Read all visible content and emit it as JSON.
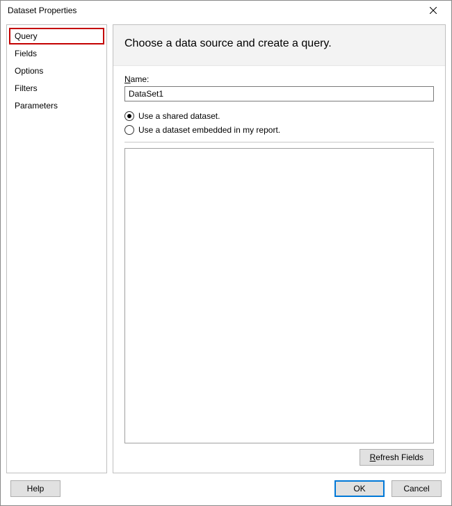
{
  "title": "Dataset Properties",
  "sidebar": {
    "items": [
      {
        "label": "Query",
        "highlight": true
      },
      {
        "label": "Fields",
        "highlight": false
      },
      {
        "label": "Options",
        "highlight": false
      },
      {
        "label": "Filters",
        "highlight": false
      },
      {
        "label": "Parameters",
        "highlight": false
      }
    ]
  },
  "main": {
    "heading": "Choose a data source and create a query.",
    "name_label_prefix": "N",
    "name_label_rest": "ame:",
    "name_value": "DataSet1",
    "radio_shared": "Use a shared dataset.",
    "radio_embedded": "Use a dataset embedded in my report.",
    "selected_radio": "shared",
    "refresh_prefix": "R",
    "refresh_rest": "efresh Fields"
  },
  "footer": {
    "help": "Help",
    "ok": "OK",
    "cancel": "Cancel"
  }
}
